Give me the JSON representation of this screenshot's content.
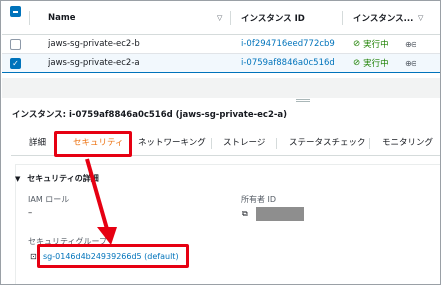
{
  "table": {
    "headers": {
      "name": "Name",
      "instance_id": "インスタンス ID",
      "state": "インスタンス..."
    },
    "rows": [
      {
        "name": "jaws-sg-private-ec2-b",
        "instance_id": "i-0f294716eed772cb9",
        "state": "実行中",
        "zoom": "⊕⊖",
        "selected": false
      },
      {
        "name": "jaws-sg-private-ec2-a",
        "instance_id": "i-0759af8846a0c516d",
        "state": "実行中",
        "zoom": "⊕⊖",
        "selected": true
      }
    ]
  },
  "detail": {
    "title": "インスタンス: i-0759af8846a0c516d (jaws-sg-private-ec2-a)",
    "tabs": [
      "詳細",
      "セキュリティ",
      "ネットワーキング",
      "ストレージ",
      "ステータスチェック",
      "モニタリング"
    ],
    "active_tab": "セキュリティ",
    "section_title": "セキュリティの詳細",
    "iam_role_label": "IAM ロール",
    "iam_role_value": "–",
    "owner_id_label": "所有者 ID",
    "sg_label": "セキュリティグループ",
    "sg_value": "sg-0146d4b24939266d5 (default)"
  },
  "colors": {
    "accent": "#0073bb",
    "active_tab": "#ec7211",
    "running": "#1d8102",
    "annotation": "#e60012"
  },
  "icons": [
    "check-circle-icon",
    "zoom-icon",
    "sort-icon",
    "caret-down-icon",
    "copy-icon",
    "external-link-icon"
  ]
}
